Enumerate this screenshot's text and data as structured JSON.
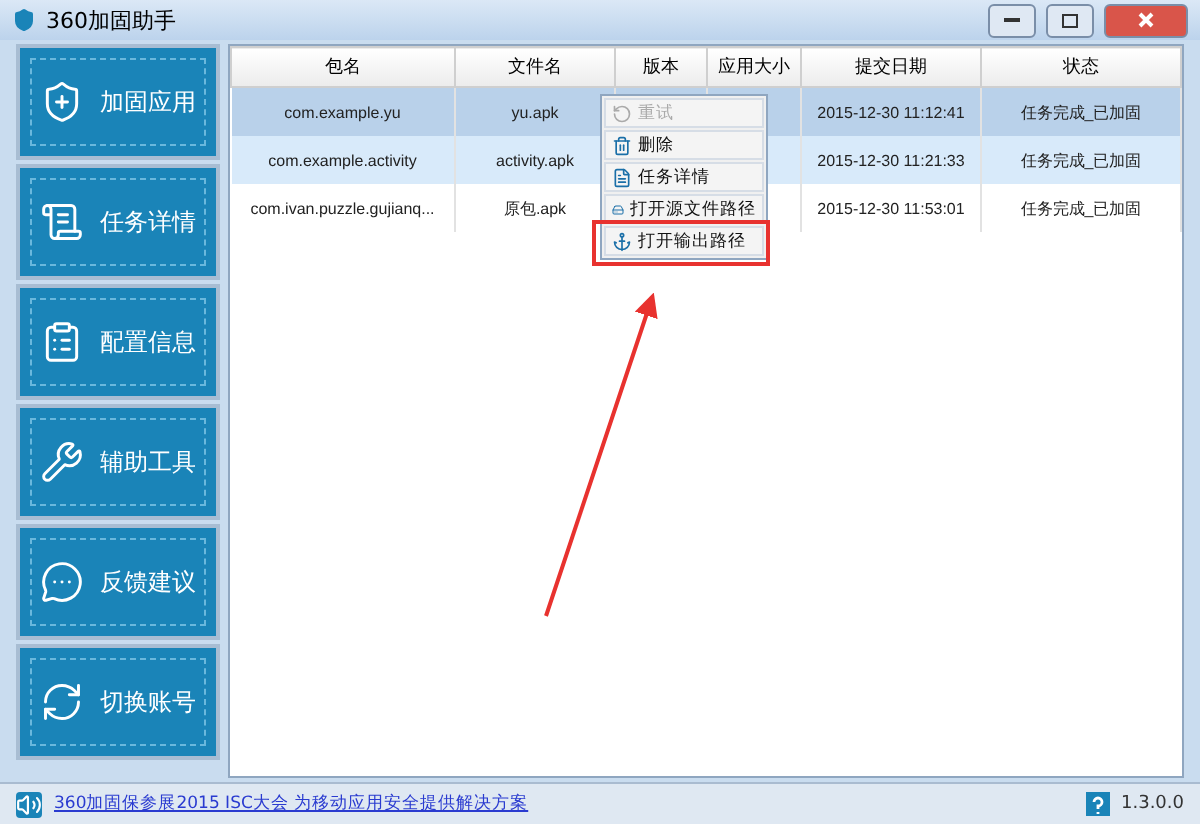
{
  "window": {
    "title": "360加固助手"
  },
  "sidebar": {
    "items": [
      {
        "label": "加固应用"
      },
      {
        "label": "任务详情"
      },
      {
        "label": "配置信息"
      },
      {
        "label": "辅助工具"
      },
      {
        "label": "反馈建议"
      },
      {
        "label": "切换账号"
      }
    ]
  },
  "table": {
    "columns": [
      "包名",
      "文件名",
      "版本",
      "应用大小",
      "提交日期",
      "状态"
    ],
    "rows": [
      {
        "cells": [
          "com.example.yu",
          "yu.apk",
          "",
          "",
          "2015-12-30 11:12:41",
          "任务完成_已加固"
        ],
        "selected": true,
        "hovered": false
      },
      {
        "cells": [
          "com.example.activity",
          "activity.apk",
          "",
          "",
          "2015-12-30 11:21:33",
          "任务完成_已加固"
        ],
        "selected": false,
        "hovered": true
      },
      {
        "cells": [
          "com.ivan.puzzle.gujianq...",
          "原包.apk",
          "",
          "",
          "2015-12-30 11:53:01",
          "任务完成_已加固"
        ],
        "selected": false,
        "hovered": false
      }
    ]
  },
  "context_menu": {
    "items": [
      {
        "label": "重试",
        "disabled": true
      },
      {
        "label": "删除",
        "disabled": false
      },
      {
        "label": "任务详情",
        "disabled": false
      },
      {
        "label": "打开源文件路径",
        "disabled": false
      },
      {
        "label": "打开输出路径",
        "disabled": false
      }
    ]
  },
  "status_bar": {
    "link": "360加固保参展2015 ISC大会 为移动应用安全提供解决方案",
    "version": "1.3.0.0"
  }
}
